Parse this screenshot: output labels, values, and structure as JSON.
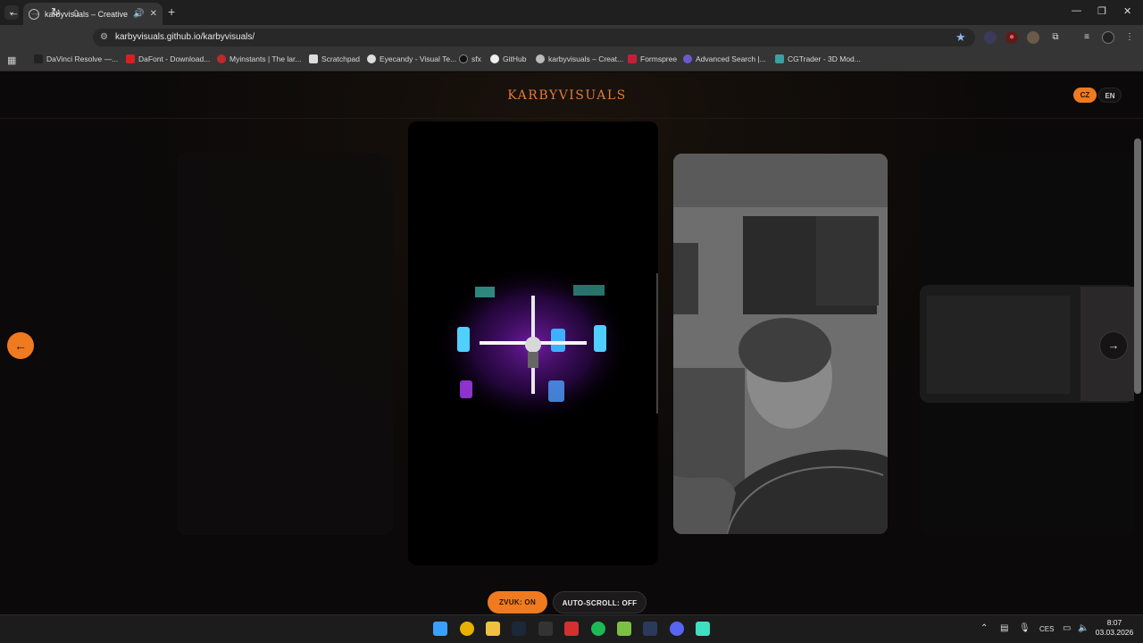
{
  "browser": {
    "tab": {
      "title": "karbyvisuals – Creative Studio"
    },
    "url": "karbyvisuals.github.io/karbyvisuals/",
    "window_controls": {
      "minimize": "—",
      "restore": "❐",
      "close": "✕"
    },
    "bookmarks": [
      {
        "label": "DaVinci Resolve —...",
        "icon_color": "#222222"
      },
      {
        "label": "DaFont - Download...",
        "icon_color": "#d92020"
      },
      {
        "label": "Myinstants | The lar...",
        "icon_color": "#c0282a"
      },
      {
        "label": "Scratchpad",
        "icon_color": "#dddddd"
      },
      {
        "label": "Eyecandy - Visual Te...",
        "icon_color": "#dddddd"
      },
      {
        "label": "sfx",
        "icon_color": "#111111"
      },
      {
        "label": "GitHub",
        "icon_color": "#eeeeee"
      },
      {
        "label": "karbyvisuals – Creat...",
        "icon_color": "#bbbbbb"
      },
      {
        "label": "Formspree",
        "icon_color": "#c41e3a"
      },
      {
        "label": "Advanced Search |...",
        "icon_color": "#6a5acd"
      },
      {
        "label": "CGTrader - 3D Mod...",
        "icon_color": "#3aa0a0"
      }
    ]
  },
  "site": {
    "brand": "KARBYVISUALS",
    "lang": {
      "cz": "CZ",
      "en": "EN",
      "active": "CZ"
    },
    "controls": {
      "sound": "ZVUK: ON",
      "autoscroll": "AUTO-SCROLL: OFF"
    },
    "nav": {
      "prev": "←",
      "next": "→"
    }
  },
  "taskbar": {
    "time": "8:07",
    "date": "03.03.2026",
    "lang": "CES"
  },
  "colors": {
    "accent": "#f07a20",
    "brand_text": "#e07a3a",
    "background": "#0b0909"
  }
}
